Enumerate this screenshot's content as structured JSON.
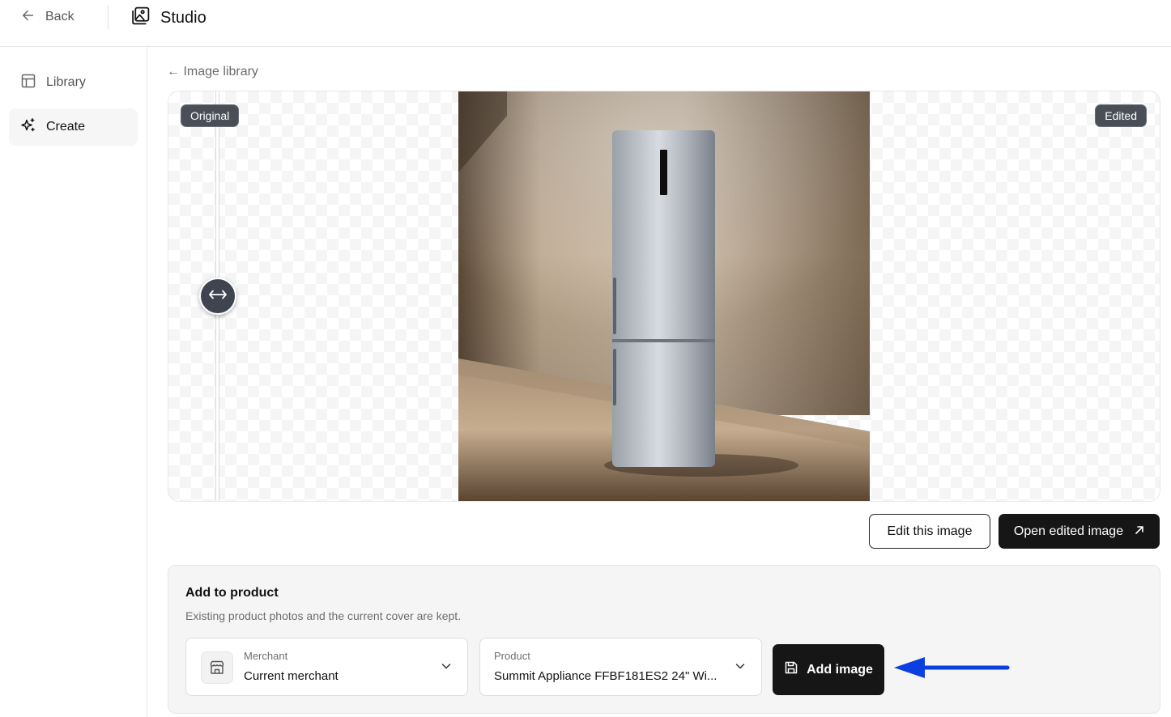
{
  "topbar": {
    "back_label": "Back",
    "back_icon": "arrow-left-icon",
    "app_icon": "image-gallery-icon",
    "app_title": "Studio"
  },
  "sidebar": {
    "items": [
      {
        "label": "Library",
        "icon": "layout-icon",
        "active": false
      },
      {
        "label": "Create",
        "icon": "sparkle-icon",
        "active": true
      }
    ]
  },
  "breadcrumb": {
    "label": "← Image library"
  },
  "viewer": {
    "original_tag": "Original",
    "edited_tag": "Edited",
    "slider_icon": "left-right-arrows-icon"
  },
  "actions": {
    "edit_label": "Edit this image",
    "open_label": "Open edited image",
    "open_icon": "external-arrow-icon"
  },
  "add_to_product": {
    "title": "Add to product",
    "subtitle": "Existing product photos and the current cover are kept.",
    "merchant": {
      "label": "Merchant",
      "value": "Current merchant",
      "icon": "store-icon"
    },
    "product": {
      "label": "Product",
      "value": "Summit Appliance FFBF181ES2 24\" Wi..."
    },
    "add_button_label": "Add image",
    "add_button_icon": "save-icon"
  },
  "colors": {
    "primary_dark": "#161616",
    "tag_bg": "#4a4e57",
    "annotation_arrow": "#0b3fe0"
  }
}
